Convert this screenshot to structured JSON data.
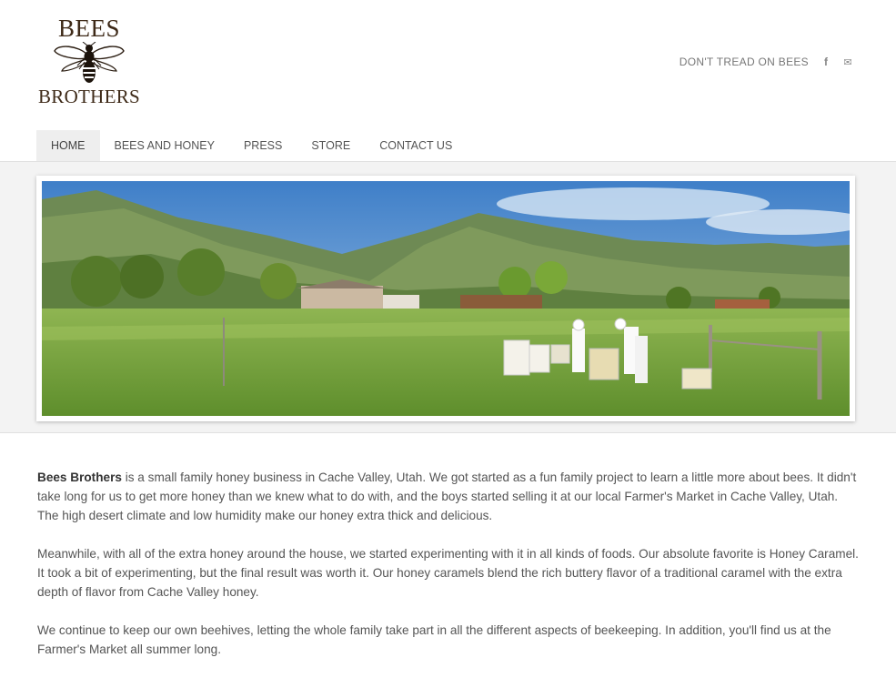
{
  "logo": {
    "top_text": "BEES",
    "bottom_text": "BROTHERS",
    "image": "bee-logo-icon"
  },
  "header": {
    "tagline": "DON'T TREAD ON BEES",
    "social_icons": [
      "facebook-icon",
      "mail-icon"
    ],
    "facebook_glyph": "f",
    "mail_glyph": "✉"
  },
  "nav": {
    "items": [
      {
        "label": "HOME",
        "active": true
      },
      {
        "label": "BEES AND HONEY",
        "active": false
      },
      {
        "label": "PRESS",
        "active": false
      },
      {
        "label": "STORE",
        "active": false
      },
      {
        "label": "CONTACT US",
        "active": false
      }
    ]
  },
  "banner": {
    "image": "beekeepers-field-mountains-photo"
  },
  "content": {
    "p1_bold": "Bees Brothers",
    "p1_rest": " is a small family honey business in Cache Valley, Utah.  We got started as a fun family project to learn a little more about bees. It didn't take long for us to get more honey than we knew what to do with, and the boys started selling it at our local Farmer's Market in Cache Valley, Utah. The high desert climate and low humidity make our honey extra thick and delicious.",
    "p2": "Meanwhile, with all of the extra honey around the house, we started experimenting with it in all kinds of foods. Our absolute favorite is Honey Caramel.  It took a bit of experimenting, but the final result was worth it. Our honey caramels blend the rich buttery flavor of a traditional caramel with the extra depth of flavor from Cache Valley honey.",
    "p3": "We continue to keep our own beehives, letting the whole family take part in all the different aspects of beekeeping.  In addition, you'll find us at the Farmer's Market all summer long."
  }
}
